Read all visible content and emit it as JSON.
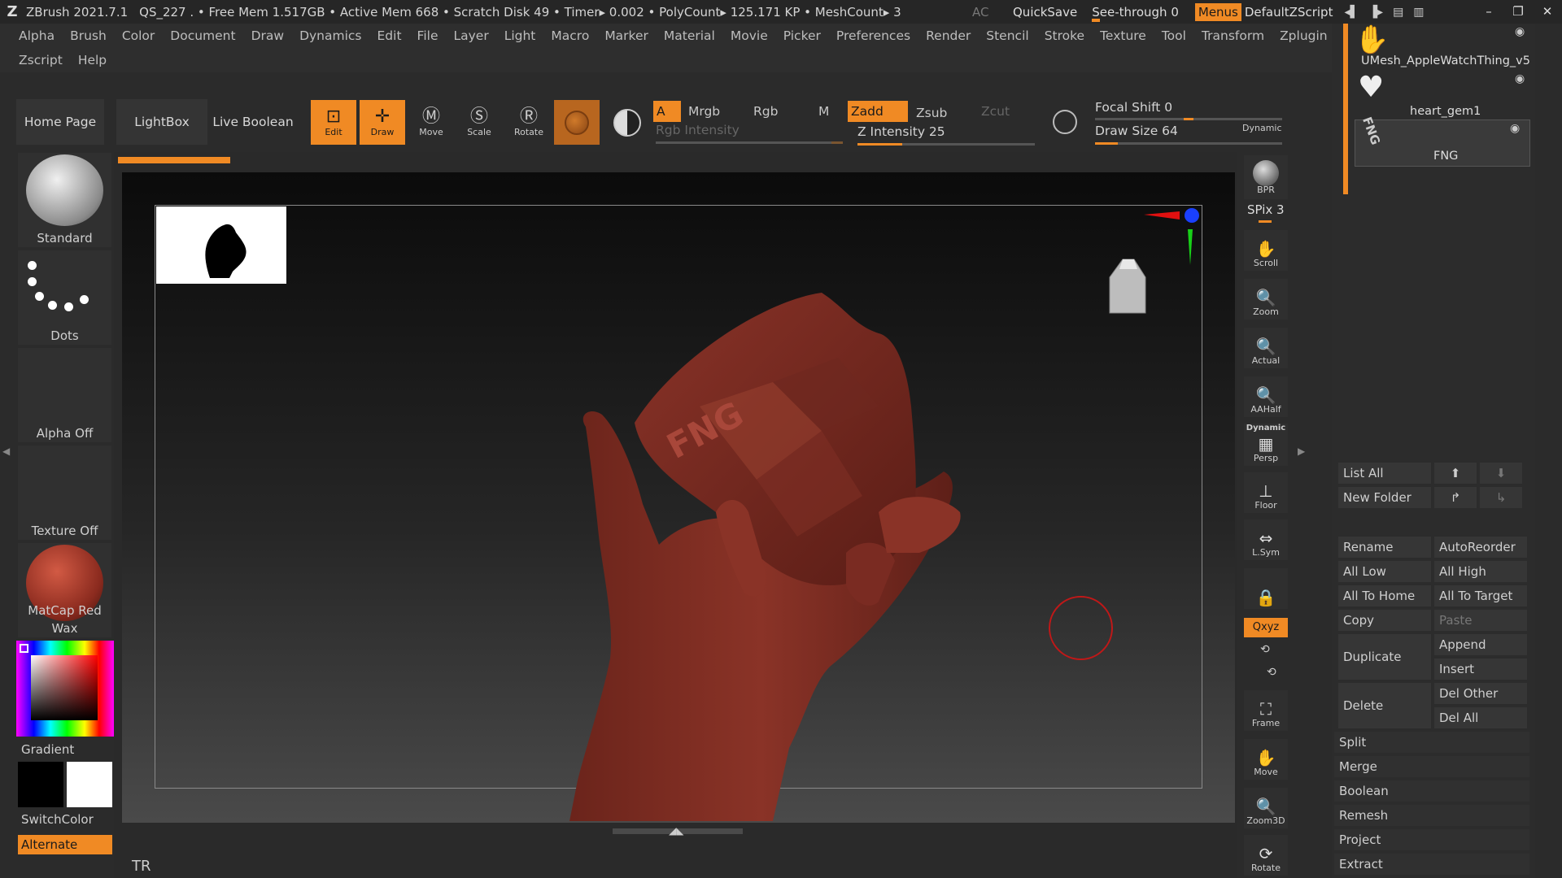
{
  "titlebar": {
    "app": "ZBrush 2021.7.1",
    "info": "QS_227   . • Free Mem 1.517GB • Active Mem 668 • Scratch Disk 49 •  Timer▸ 0.002 • PolyCount▸ 125.171 KP  • MeshCount▸ 3",
    "ac": "AC",
    "quicksave": "QuickSave",
    "seethrough": "See-through  0",
    "menus": "Menus",
    "script": "DefaultZScript"
  },
  "menubar": {
    "row1": [
      "Alpha",
      "Brush",
      "Color",
      "Document",
      "Draw",
      "Dynamics",
      "Edit",
      "File",
      "Layer",
      "Light",
      "Macro",
      "Marker",
      "Material",
      "Movie",
      "Picker",
      "Preferences",
      "Render",
      "Stencil",
      "Stroke",
      "Texture",
      "Tool",
      "Transform",
      "Zplugin"
    ],
    "row2": [
      "Zscript",
      "Help"
    ]
  },
  "toolbar": {
    "home_page": "Home Page",
    "lightbox": "LightBox",
    "live_boolean": "Live Boolean",
    "tools": {
      "edit": "Edit",
      "draw": "Draw",
      "move": "Move",
      "scale": "Scale",
      "rotate": "Rotate"
    },
    "a": "A",
    "mrgb": "Mrgb",
    "rgb": "Rgb",
    "m": "M",
    "zadd": "Zadd",
    "zsub": "Zsub",
    "zcut": "Zcut",
    "rgb_intensity": "Rgb Intensity",
    "z_intensity": "Z Intensity 25",
    "focal_shift": "Focal Shift 0",
    "draw_size": "Draw Size 64",
    "dynamic": "Dynamic",
    "z_intensity_level": 0.25,
    "draw_size_level": 0.12
  },
  "leftshelf": {
    "brush": "Standard",
    "stroke": "Dots",
    "alpha": "Alpha Off",
    "texture": "Texture Off",
    "material": "MatCap Red Wax",
    "gradient": "Gradient",
    "switchcolor": "SwitchColor",
    "alternate": "Alternate"
  },
  "canvas": {
    "bottom_label": "TR"
  },
  "rightshelf": {
    "bpr": "BPR",
    "spix": "SPix 3",
    "scroll": "Scroll",
    "zoom": "Zoom",
    "actual": "Actual",
    "aahalf": "AAHalf",
    "dynamic": "Dynamic",
    "persp": "Persp",
    "floor": "Floor",
    "lsym": "L.Sym",
    "xyz": "Qxyz",
    "frame": "Frame",
    "move": "Move",
    "zoom3d": "Zoom3D",
    "rotate": "Rotate"
  },
  "subtools": {
    "items": [
      "UMesh_AppleWatchThing_v5",
      "heart_gem1",
      "FNG"
    ],
    "list_all": "List All",
    "new_folder": "New Folder",
    "buttons": {
      "rename": "Rename",
      "autoreorder": "AutoReorder",
      "all_low": "All Low",
      "all_high": "All High",
      "all_to_home": "All To Home",
      "all_to_target": "All To Target",
      "copy": "Copy",
      "paste": "Paste",
      "duplicate": "Duplicate",
      "append": "Append",
      "insert": "Insert",
      "delete": "Delete",
      "del_other": "Del Other",
      "del_all": "Del All",
      "split": "Split",
      "merge": "Merge",
      "boolean": "Boolean",
      "remesh": "Remesh",
      "project": "Project",
      "extract": "Extract"
    }
  },
  "colors": {
    "accent": "#f08a24",
    "model": "#7a2a22"
  }
}
